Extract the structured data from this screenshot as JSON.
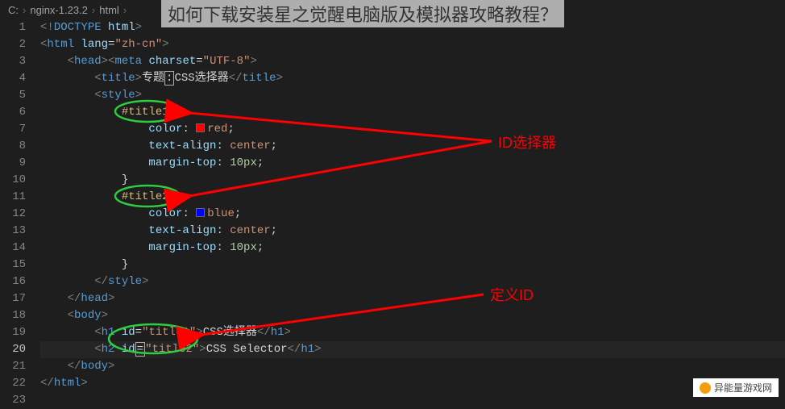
{
  "breadcrumb": {
    "c": "C:",
    "nginx": "nginx-1.23.2",
    "html": "html"
  },
  "overlay": {
    "title": "如何下载安装星之觉醒电脑版及模拟器攻略教程？"
  },
  "annotations": {
    "id_selector": "ID选择器",
    "define_id": "定义ID"
  },
  "watermark": {
    "text": "异能量游戏网"
  },
  "code": {
    "l1_doctype": "DOCTYPE",
    "l1_html": "html",
    "l2_html": "html",
    "l2_lang": "lang",
    "l2_langv": "\"zh-cn\"",
    "l3_head": "head",
    "l3_meta": "meta",
    "l3_charset": "charset",
    "l3_charsetv": "\"UTF-8\"",
    "l4_title": "title",
    "l4_text1": "专题",
    "l4_text2": "CSS选择器",
    "l5_style": "style",
    "l6_sel": "#title1",
    "l6_br": "{",
    "l7_prop": "color",
    "l7_val": "red",
    "l8_prop": "text-align",
    "l8_val": "center",
    "l9_prop": "margin-top",
    "l9_val": "10px",
    "l10_br": "}",
    "l11_sel": "#title2",
    "l11_br": "{",
    "l12_prop": "color",
    "l12_val": "blue",
    "l13_prop": "text-align",
    "l13_val": "center",
    "l14_prop": "margin-top",
    "l14_val": "10px",
    "l15_br": "}",
    "l16_style": "style",
    "l17_head": "head",
    "l18_body": "body",
    "l19_h": "h1",
    "l19_id": "id",
    "l19_idv": "\"title1\"",
    "l19_txt": "CSS选择器",
    "l20_h": "h2",
    "l20_id": "id",
    "l20_eq": "=",
    "l20_idv": "\"title2\"",
    "l20_txt": "CSS Selector",
    "l20_close": "h1",
    "l21_body": "body",
    "l22_html": "html"
  },
  "lines": [
    "1",
    "2",
    "3",
    "4",
    "5",
    "6",
    "7",
    "8",
    "9",
    "10",
    "11",
    "12",
    "13",
    "14",
    "15",
    "16",
    "17",
    "18",
    "19",
    "20",
    "21",
    "22",
    "23"
  ]
}
